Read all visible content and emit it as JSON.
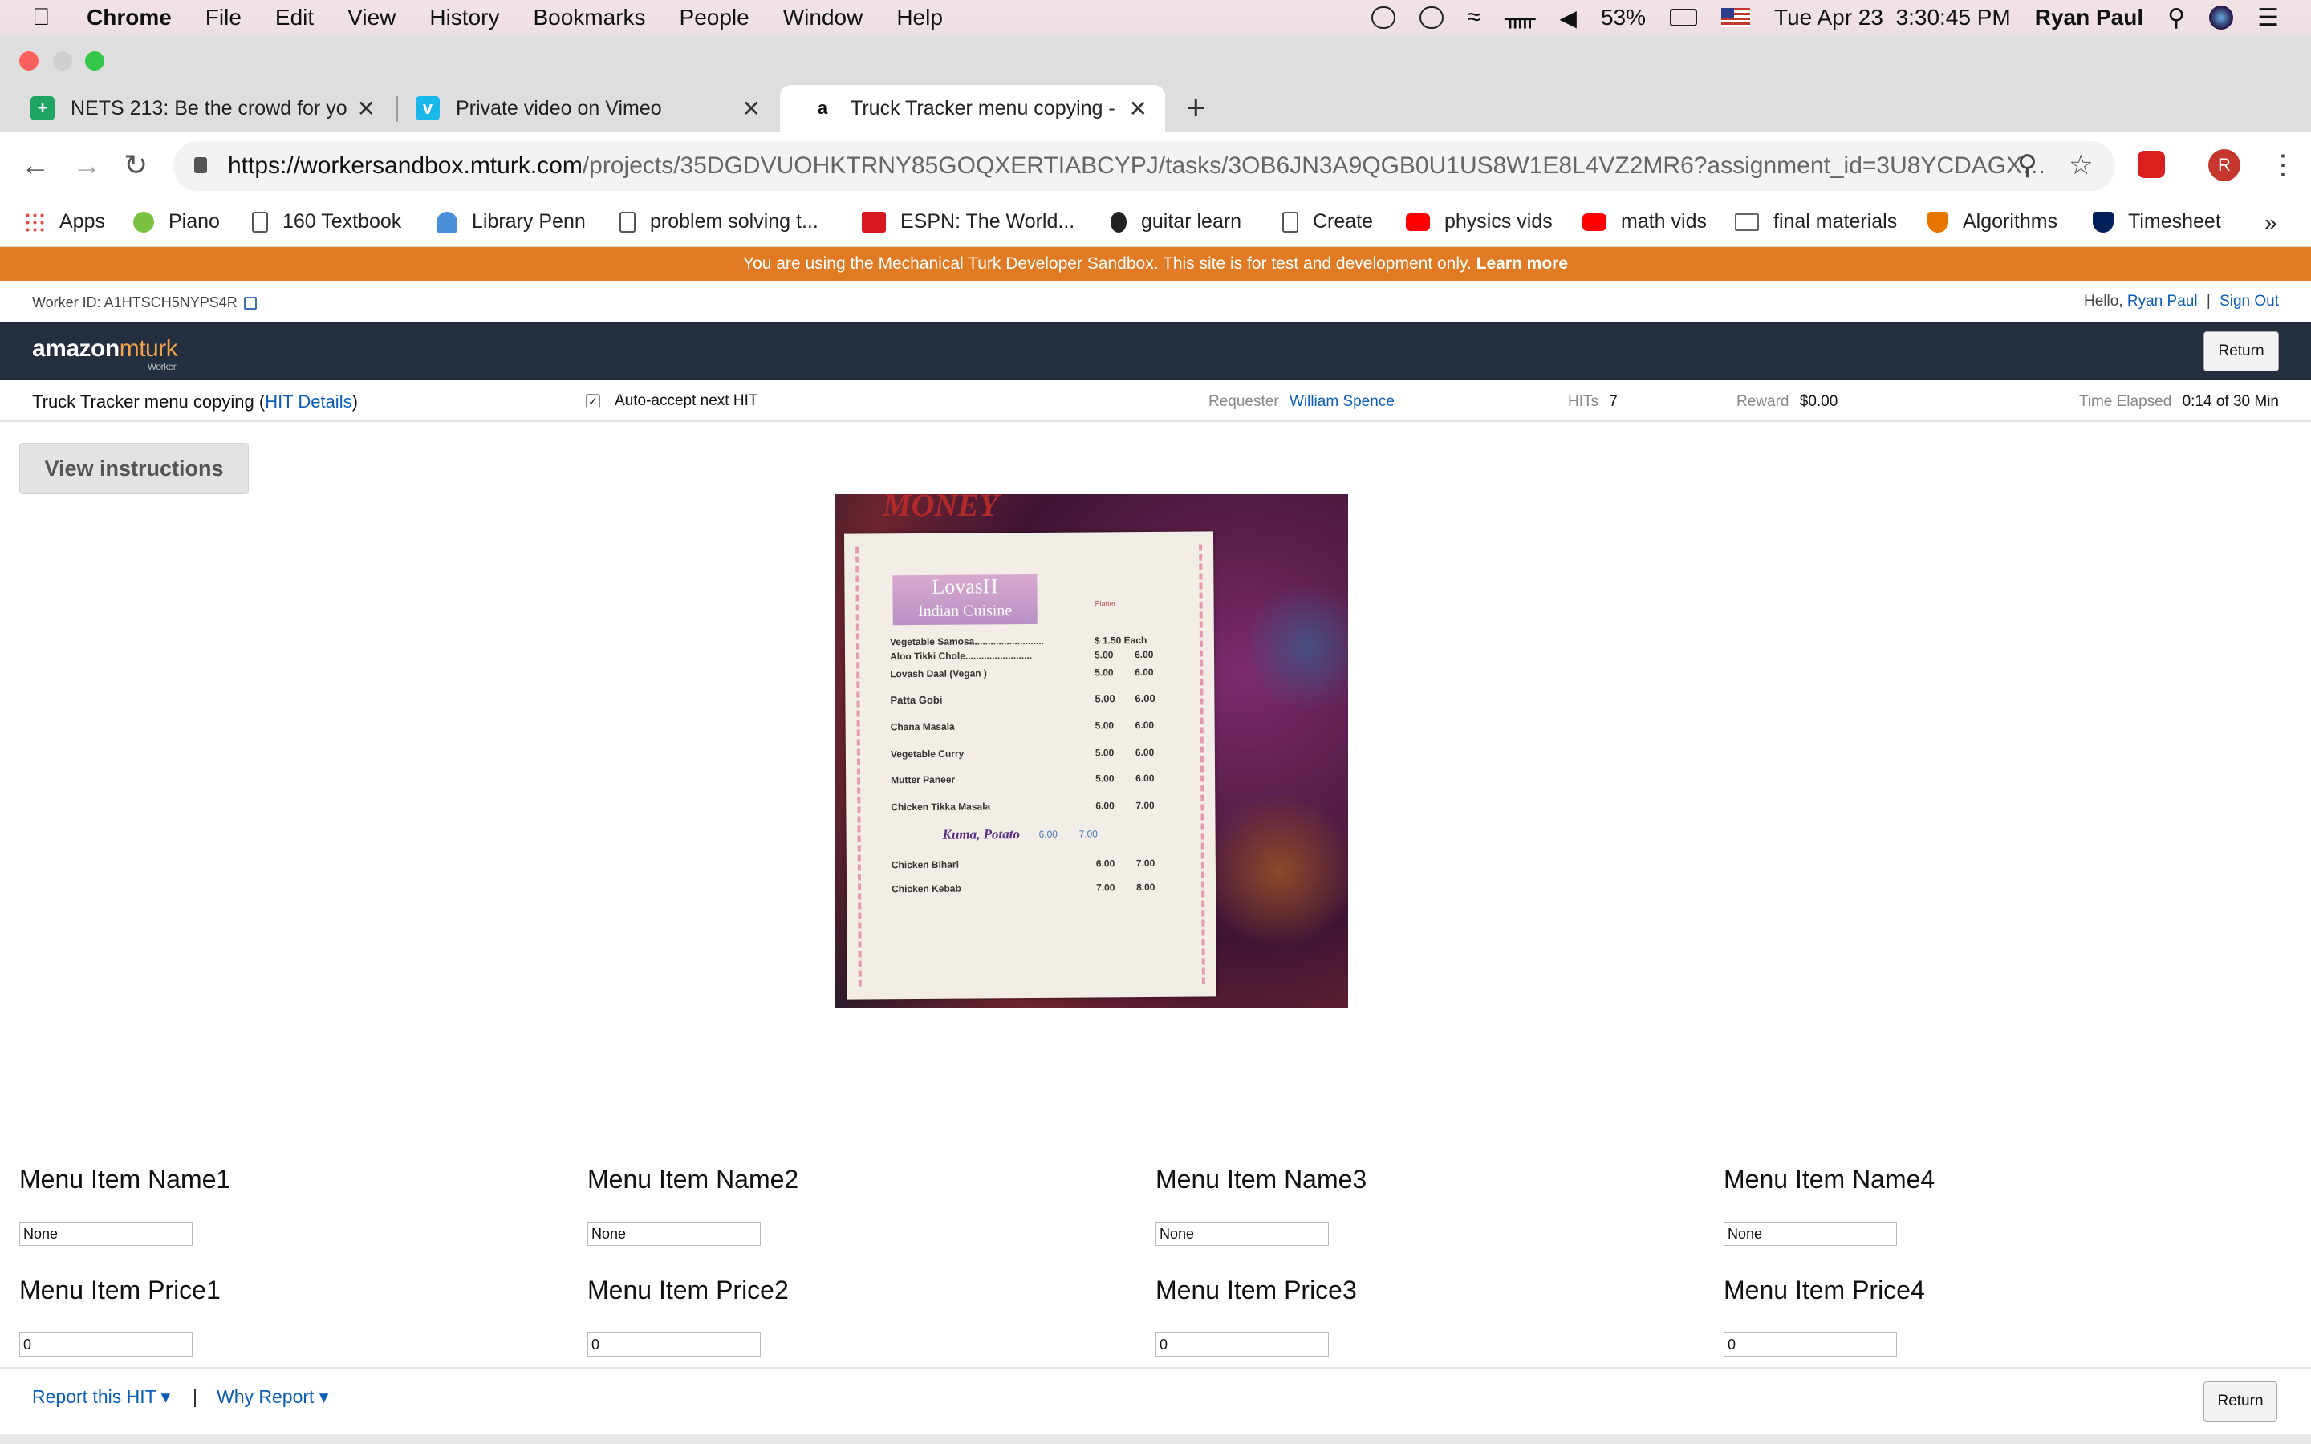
{
  "menubar": {
    "app": "Chrome",
    "items": [
      "File",
      "Edit",
      "View",
      "History",
      "Bookmarks",
      "People",
      "Window",
      "Help"
    ],
    "battery": "53%",
    "datetime": "Tue Apr 23  3:30:45 PM",
    "user": "Ryan Paul"
  },
  "tabs": [
    {
      "label": "NETS 213: Be the crowd for yo",
      "icon": "google-sheets-icon",
      "color": "#1fa463"
    },
    {
      "label": "Private video on Vimeo",
      "icon": "vimeo-icon",
      "color": "#1ab7ea"
    },
    {
      "label": "Truck Tracker menu copying - ",
      "icon": "amazon-icon",
      "color": "#ffffff"
    }
  ],
  "omnibox": {
    "url_host": "https://workersandbox.mturk.com",
    "url_path": "/projects/35DGDVUOHKTRNY85GOQXERTIABCYPJ/tasks/3OB6JN3A9QGB0U1US8W1E8L4VZ2MR6?assignment_id=3U8YCDAGX…",
    "profile_initial": "R"
  },
  "bookmarks": [
    {
      "label": "Apps",
      "icon": "apps-grid-icon",
      "color": "#e8453c"
    },
    {
      "label": "Piano",
      "icon": "piano-icon",
      "color": "#7cc242"
    },
    {
      "label": "160 Textbook",
      "icon": "document-icon",
      "color": "#ffffff"
    },
    {
      "label": "Library Penn",
      "icon": "library-icon",
      "color": "#4a90d9"
    },
    {
      "label": "problem solving t...",
      "icon": "document-icon",
      "color": "#ffffff"
    },
    {
      "label": "ESPN: The World...",
      "icon": "espn-icon",
      "color": "#d71920"
    },
    {
      "label": "guitar learn",
      "icon": "guitar-icon",
      "color": "#222222"
    },
    {
      "label": "Create",
      "icon": "document-icon",
      "color": "#ffffff"
    },
    {
      "label": "physics vids",
      "icon": "youtube-icon",
      "color": "#ff0000"
    },
    {
      "label": "math vids",
      "icon": "youtube-icon",
      "color": "#ff0000"
    },
    {
      "label": "final materials",
      "icon": "folder-icon",
      "color": "#cfcfcf"
    },
    {
      "label": "Algorithms",
      "icon": "princeton-shield-icon",
      "color": "#e77500"
    },
    {
      "label": "Timesheet",
      "icon": "penn-shield-icon",
      "color": "#011f5b"
    }
  ],
  "sandbox_banner": {
    "text": "You are using the Mechanical Turk Developer Sandbox. This site is for test and development only.",
    "link": "Learn more"
  },
  "worker": {
    "id_text": "Worker ID: A1HTSCH5NYPS4R",
    "hello": "Hello,",
    "name": "Ryan Paul",
    "sep": "|",
    "signout": "Sign Out"
  },
  "header": {
    "logo_main": "amazon",
    "logo_accent": "mturk",
    "logo_sub": "Worker",
    "return_label": "Return"
  },
  "hit": {
    "title": "Truck Tracker menu copying",
    "details_link": "HIT Details",
    "auto_accept": "Auto-accept next HIT",
    "requester_label": "Requester",
    "requester": "William Spence",
    "hits_label": "HITs",
    "hits": "7",
    "reward_label": "Reward",
    "reward": "$0.00",
    "elapsed_label": "Time Elapsed",
    "elapsed": "0:14 of 30 Min"
  },
  "view_instructions": "View instructions",
  "menu_photo": {
    "top_text": "MONEY",
    "logo_line1": "LovasH",
    "logo_line2": "Indian Cuisine",
    "platter": "Platter",
    "items": [
      {
        "name": "Vegetable Samosa..........................",
        "p1": "$ 1.50 Each",
        "p2": ""
      },
      {
        "name": "Aloo Tikki Chole.........................",
        "p1": "5.00",
        "p2": "6.00"
      },
      {
        "name": "Lovash Daal (Vegan )",
        "p1": "5.00",
        "p2": "6.00"
      },
      {
        "name": "Patta Gobi",
        "p1": "5.00",
        "p2": "6.00"
      },
      {
        "name": "Chana Masala",
        "p1": "5.00",
        "p2": "6.00"
      },
      {
        "name": "Vegetable Curry",
        "p1": "5.00",
        "p2": "6.00"
      },
      {
        "name": "Mutter Paneer",
        "p1": "5.00",
        "p2": "6.00"
      },
      {
        "name": "Chicken Tikka Masala",
        "p1": "6.00",
        "p2": "7.00"
      },
      {
        "name": "Kuma, Potato",
        "p1": "6.00",
        "p2": "7.00"
      },
      {
        "name": "Chicken Bihari",
        "p1": "6.00",
        "p2": "7.00"
      },
      {
        "name": "Chicken Kebab",
        "p1": "7.00",
        "p2": "8.00"
      }
    ]
  },
  "form": {
    "names": [
      {
        "label": "Menu Item Name1",
        "value": "None"
      },
      {
        "label": "Menu Item Name2",
        "value": "None"
      },
      {
        "label": "Menu Item Name3",
        "value": "None"
      },
      {
        "label": "Menu Item Name4",
        "value": "None"
      }
    ],
    "prices": [
      {
        "label": "Menu Item Price1",
        "value": "0"
      },
      {
        "label": "Menu Item Price2",
        "value": "0"
      },
      {
        "label": "Menu Item Price3",
        "value": "0"
      },
      {
        "label": "Menu Item Price4",
        "value": "0"
      }
    ]
  },
  "footer": {
    "report": "Report this HIT",
    "sep": "|",
    "why": "Why Report",
    "return_label": "Return"
  },
  "colors": {
    "sandbox_orange": "#e07b23",
    "amazon_dark": "#232f3e",
    "link_blue": "#0a5eb8"
  }
}
